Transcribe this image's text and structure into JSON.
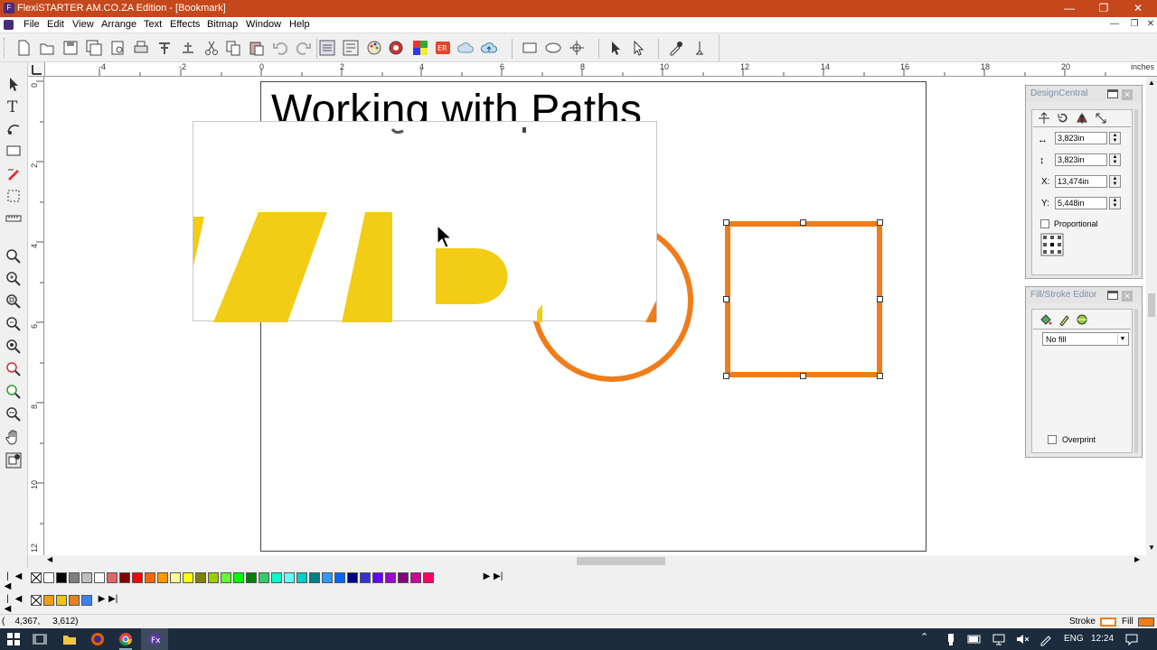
{
  "window": {
    "title": "FlexiSTARTER AM.CO.ZA Edition - [Bookmark]",
    "app_icon": "flexi-app-icon"
  },
  "menu": [
    "File",
    "Edit",
    "View",
    "Arrange",
    "Text",
    "Effects",
    "Bitmap",
    "Window",
    "Help"
  ],
  "ruler": {
    "unit": "inches",
    "h_ticks": [
      "-4",
      "-2",
      "0",
      "2",
      "4",
      "6",
      "8",
      "10",
      "12",
      "14",
      "16",
      "18",
      "20"
    ],
    "v_ticks": [
      "0",
      "2",
      "4",
      "6",
      "8",
      "10",
      "12"
    ]
  },
  "canvas": {
    "heading": "Working with Paths"
  },
  "design_central": {
    "title": "DesignCentral",
    "width": "3,823in",
    "height": "3,823in",
    "x_label": "X:",
    "x": "13,474in",
    "y_label": "Y:",
    "y": "5,448in",
    "proportional_label": "Proportional"
  },
  "fill_stroke": {
    "title": "Fill/Stroke Editor",
    "fill_value": "No fill",
    "overprint_label": "Overprint"
  },
  "palette1_colors": [
    "#ffffff",
    "#000000",
    "#7f7f7f",
    "#c0c0c0",
    "#ffffff",
    "#e06666",
    "#800000",
    "#ff0000",
    "#ff6600",
    "#ff9900",
    "#ffff99",
    "#ffff00",
    "#808000",
    "#99cc00",
    "#66ff33",
    "#00ff00",
    "#008000",
    "#33cc66",
    "#00ffcc",
    "#66ffff",
    "#00cccc",
    "#008080",
    "#3399ff",
    "#0066ff",
    "#000080",
    "#3333cc",
    "#6600ff",
    "#9900cc",
    "#800080",
    "#cc0099",
    "#ff0066"
  ],
  "palette2_colors": [
    "#f39c12",
    "#f1c40f",
    "#e67e22",
    "#3b82f6"
  ],
  "status": {
    "coords": "(    4,367,     3,612)",
    "stroke_label": "Stroke",
    "fill_label": "Fill",
    "stroke_color": "#ffffff",
    "fill_color": "#f07c1a"
  },
  "taskbar": {
    "language": "ENG",
    "time": "12:24"
  },
  "colors": {
    "titlebar": "#c4481b",
    "shape_orange": "#f07c1a",
    "wide_yellow": "#f2cc15"
  }
}
